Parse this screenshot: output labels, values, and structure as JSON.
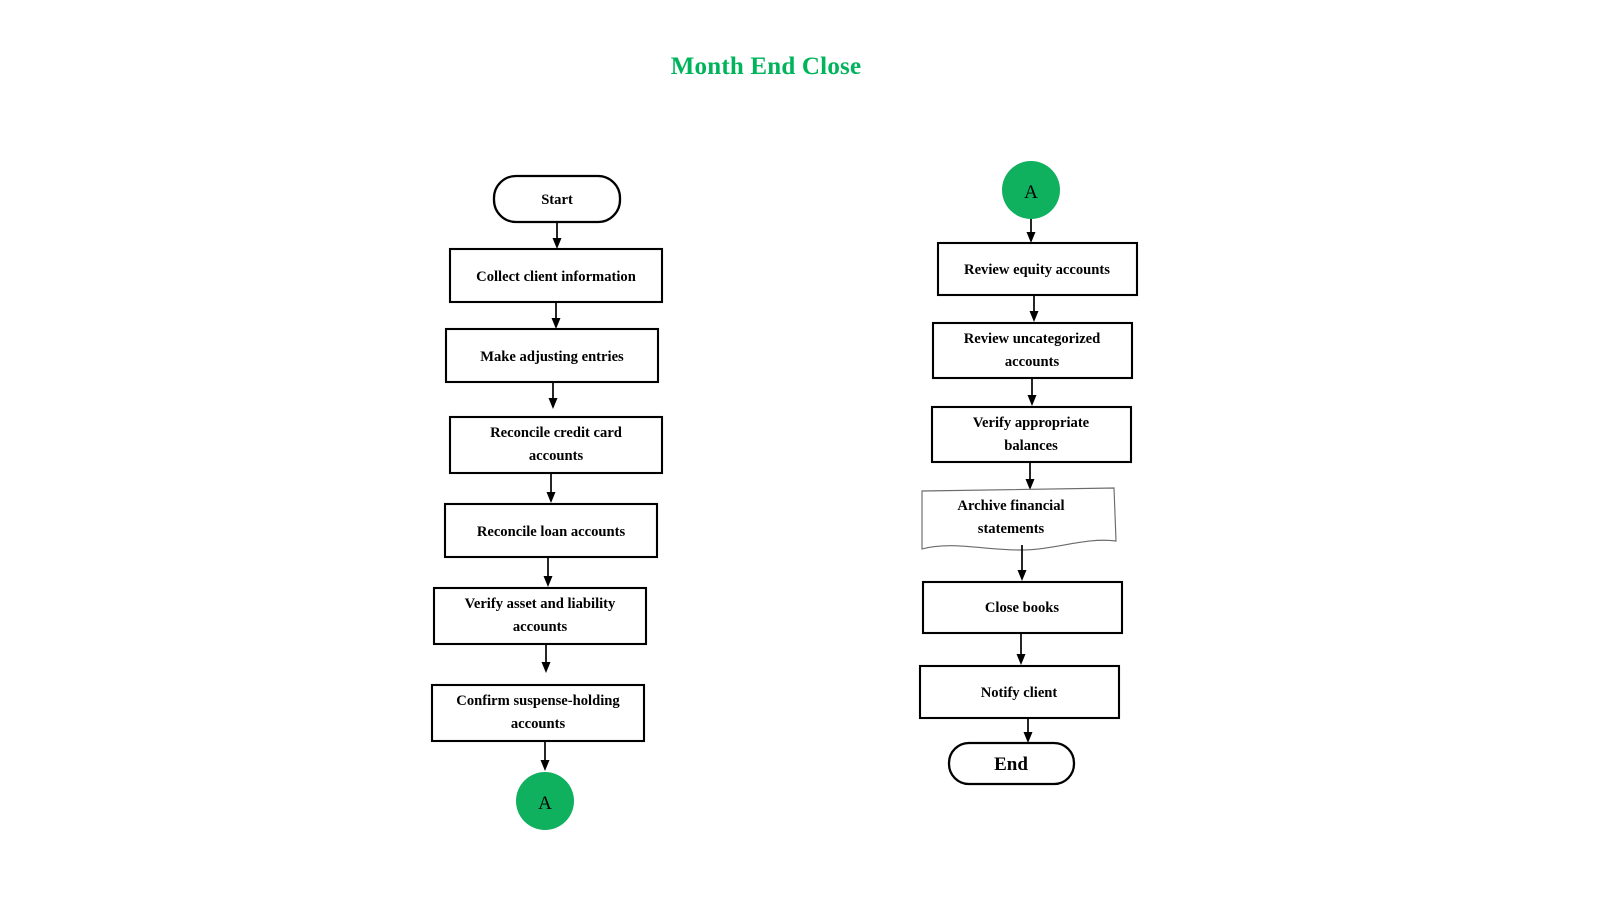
{
  "title": {
    "text": "Month End Close",
    "color": "#00b45c"
  },
  "theme": {
    "background": "#ffffff",
    "node_fill": "#ffffff",
    "node_stroke": "#000000",
    "connector_fill": "#0fb05e",
    "document_stroke": "#6b6b6b",
    "edge_color": "#000000"
  },
  "columns": [
    {
      "name": "left-column",
      "nodes": [
        {
          "id": "start",
          "label": "Start",
          "shape": "terminator"
        },
        {
          "id": "collect-info",
          "label": "Collect client information",
          "shape": "process"
        },
        {
          "id": "adjusting-entries",
          "label": "Make adjusting entries",
          "shape": "process"
        },
        {
          "id": "reconcile-credit",
          "label": "Reconcile credit card accounts",
          "shape": "process"
        },
        {
          "id": "reconcile-loan",
          "label": "Reconcile loan accounts",
          "shape": "process"
        },
        {
          "id": "verify-asset",
          "label": "Verify asset and liability accounts",
          "shape": "process"
        },
        {
          "id": "confirm-suspense",
          "label": "Confirm suspense-holding accounts",
          "shape": "process"
        },
        {
          "id": "connector-a-out",
          "label": "A",
          "shape": "connector"
        }
      ]
    },
    {
      "name": "right-column",
      "nodes": [
        {
          "id": "connector-a-in",
          "label": "A",
          "shape": "connector"
        },
        {
          "id": "review-equity",
          "label": "Review equity accounts",
          "shape": "process"
        },
        {
          "id": "review-uncat",
          "label": "Review uncategorized accounts",
          "shape": "process"
        },
        {
          "id": "verify-balances",
          "label": "Verify appropriate balances",
          "shape": "process"
        },
        {
          "id": "archive-fin",
          "label": "Archive financial statements",
          "shape": "document"
        },
        {
          "id": "close-books",
          "label": "Close books",
          "shape": "process"
        },
        {
          "id": "notify-client",
          "label": "Notify client",
          "shape": "process"
        },
        {
          "id": "end",
          "label": "End",
          "shape": "terminator"
        }
      ]
    }
  ],
  "node_text": {
    "start": [
      "Start"
    ],
    "collect_info": [
      "Collect client information"
    ],
    "adjusting_entries": [
      "Make adjusting entries"
    ],
    "reconcile_credit_l1": [
      "Reconcile credit card"
    ],
    "reconcile_credit_l2": [
      "accounts"
    ],
    "reconcile_loan": [
      "Reconcile loan accounts"
    ],
    "verify_asset_l1": [
      "Verify asset and liability"
    ],
    "verify_asset_l2": [
      "accounts"
    ],
    "confirm_suspense_l1": [
      "Confirm suspense-holding"
    ],
    "confirm_suspense_l2": [
      "accounts"
    ],
    "connector_a_out": [
      "A"
    ],
    "connector_a_in": [
      "A"
    ],
    "review_equity": [
      "Review equity accounts"
    ],
    "review_uncat_l1": [
      "Review uncategorized"
    ],
    "review_uncat_l2": [
      "accounts"
    ],
    "verify_balances_l1": [
      "Verify appropriate"
    ],
    "verify_balances_l2": [
      "balances"
    ],
    "archive_fin_l1": [
      "Archive financial"
    ],
    "archive_fin_l2": [
      "statements"
    ],
    "close_books": [
      "Close books"
    ],
    "notify_client": [
      "Notify client"
    ],
    "end": [
      "End"
    ]
  },
  "labels": {
    "title": "Month End Close",
    "start": "Start",
    "collect_info": "Collect client information",
    "adjusting_entries": "Make adjusting entries",
    "reconcile_credit_1": "Reconcile credit card",
    "reconcile_credit_2": "accounts",
    "reconcile_loan": "Reconcile loan accounts",
    "verify_asset_1": "Verify asset and liability",
    "verify_asset_2": "accounts",
    "confirm_suspense_1": "Confirm suspense-holding",
    "confirm_suspense_2": "accounts",
    "connector_out": "A",
    "connector_in": "A",
    "review_equity": "Review equity accounts",
    "review_uncat_1": "Review uncategorized",
    "review_uncat_2": "accounts",
    "verify_balances_1": "Verify appropriate",
    "verify_balances_2": "balances",
    "archive_fin_1": "Archive financial",
    "archive_fin_2": "statements",
    "close_books": "Close books",
    "notify_client": "Notify client",
    "end": "End"
  }
}
